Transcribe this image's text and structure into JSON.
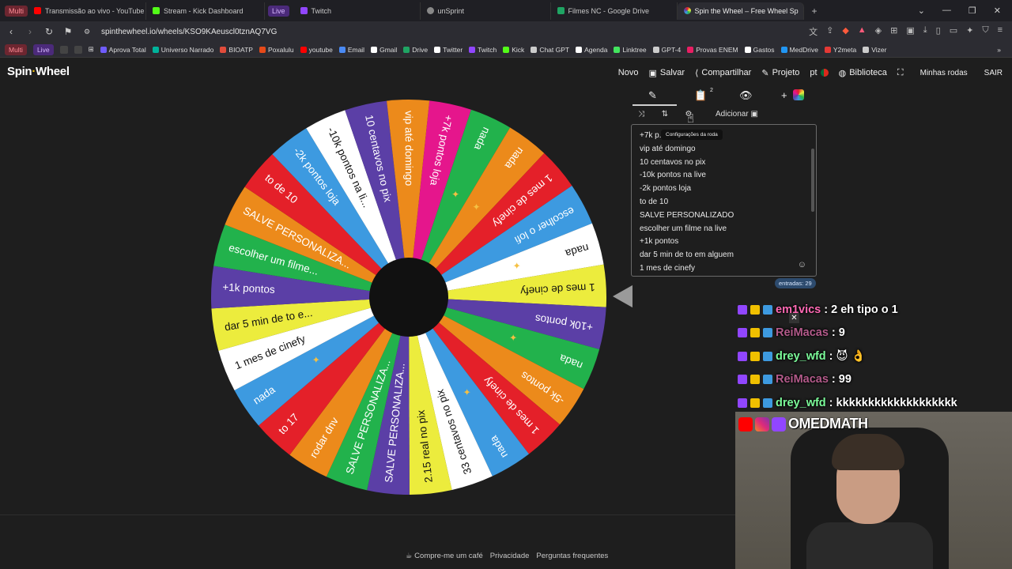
{
  "browser": {
    "profile_chip": "Multi",
    "tabs": [
      {
        "label": "Transmissão ao vivo - YouTube Studio",
        "color": "#ff0000"
      },
      {
        "label": "Stream - Kick Dashboard",
        "color": "#53fc18"
      },
      {
        "label": "Twitch",
        "color": "#9146ff"
      },
      {
        "label": "unSprint",
        "color": "#aaaaaa"
      },
      {
        "label": "Filmes NC - Google Drive",
        "color": "#1fa463"
      },
      {
        "label": "Spin the Wheel – Free Wheel Sp",
        "color": "#3b82f6"
      }
    ],
    "tab_live_chip": "Live",
    "url": "spinthewheel.io/wheels/KSO9KAeuscl0tznAQ7VG",
    "bookmarks": [
      {
        "label": "Aprova Total",
        "color": "#6f5cff"
      },
      {
        "label": "Universo Narrado",
        "color": "#00b39b"
      },
      {
        "label": "BIOATP",
        "color": "#e24c3b"
      },
      {
        "label": "Poxalulu",
        "color": "#e64a19"
      },
      {
        "label": "youtube",
        "color": "#ff0000"
      },
      {
        "label": "Email",
        "color": "#4a8af4"
      },
      {
        "label": "Gmail",
        "color": "#ffffff"
      },
      {
        "label": "Drive",
        "color": "#1fa463"
      },
      {
        "label": "Twitter",
        "color": "#ffffff"
      },
      {
        "label": "Twitch",
        "color": "#9146ff"
      },
      {
        "label": "Kick",
        "color": "#53fc18"
      },
      {
        "label": "Chat GPT",
        "color": "#cccccc"
      },
      {
        "label": "Agenda",
        "color": "#ffffff"
      },
      {
        "label": "Linktree",
        "color": "#43e55e"
      },
      {
        "label": "GPT-4",
        "color": "#cccccc"
      },
      {
        "label": "Provas ENEM",
        "color": "#e91e63"
      },
      {
        "label": "Gastos",
        "color": "#ffffff"
      },
      {
        "label": "MedDrive",
        "color": "#2196f3"
      },
      {
        "label": "Y2meta",
        "color": "#e53935"
      },
      {
        "label": "Vizer",
        "color": "#cccccc"
      }
    ],
    "bookmark_chips": [
      "Multi",
      "Live"
    ]
  },
  "app": {
    "logo_main": "Spin",
    "logo_dot": "·",
    "logo_end": "Wheel",
    "menu": {
      "novo": "Novo",
      "salvar": "Salvar",
      "compartilhar": "Compartilhar",
      "projeto": "Projeto",
      "language": "pt",
      "biblioteca": "Biblioteca",
      "minhas_rodas": "Minhas rodas",
      "sair": "SAIR"
    }
  },
  "wheel": {
    "segments": [
      {
        "label": "+7k pontos loja",
        "color": "#e5168c"
      },
      {
        "label": "nada",
        "color": "#22b24c",
        "star": true
      },
      {
        "label": "nada",
        "color": "#ec8a1b",
        "star": true
      },
      {
        "label": "1 mes de cinefy",
        "color": "#e42029"
      },
      {
        "label": "escolher o lofi",
        "color": "#3d9ae0"
      },
      {
        "label": "nada",
        "color": "#ffffff",
        "star": true
      },
      {
        "label": "1 mes de cinefy",
        "color": "#ecec3d"
      },
      {
        "label": "+10k pontos",
        "color": "#5b3fa6"
      },
      {
        "label": "nada",
        "color": "#22b24c",
        "star": true
      },
      {
        "label": "-5k pontos",
        "color": "#ec8a1b"
      },
      {
        "label": "1 mes de cinefy",
        "color": "#e42029"
      },
      {
        "label": "nada",
        "color": "#3d9ae0",
        "star": true
      },
      {
        "label": "33 centavos no pix",
        "color": "#ffffff"
      },
      {
        "label": "2.15 real no pix",
        "color": "#ecec3d"
      },
      {
        "label": "SALVE PERSONALIZA...",
        "color": "#5b3fa6"
      },
      {
        "label": "SALVE PERSONALIZA...",
        "color": "#22b24c"
      },
      {
        "label": "rodar dnv",
        "color": "#ec8a1b"
      },
      {
        "label": "to 17",
        "color": "#e42029"
      },
      {
        "label": "nada",
        "color": "#3d9ae0",
        "star": true
      },
      {
        "label": "1 mes de cinefy",
        "color": "#ffffff"
      },
      {
        "label": "dar 5 min de to e...",
        "color": "#ecec3d"
      },
      {
        "label": "+1k pontos",
        "color": "#5b3fa6"
      },
      {
        "label": "escolher um filme...",
        "color": "#22b24c"
      },
      {
        "label": "SALVE PERSONALIZA...",
        "color": "#ec8a1b"
      },
      {
        "label": "to de 10",
        "color": "#e42029"
      },
      {
        "label": "-2k pontos loja",
        "color": "#3d9ae0"
      },
      {
        "label": "-10k pontos na li...",
        "color": "#ffffff"
      },
      {
        "label": "10 centavos no pix",
        "color": "#5b3fa6"
      },
      {
        "label": "vip até domingo",
        "color": "#ec8a1b"
      }
    ]
  },
  "editor": {
    "add_label": "Adicionar",
    "tooltip": "Configurações da roda",
    "notes_count": "2",
    "entries": [
      "+7k p...",
      "vip até domingo",
      "10 centavos no pix",
      "-10k pontos na live",
      "-2k pontos loja",
      "to de 10",
      "SALVE PERSONALIZADO",
      "escolher um filme na live",
      "+1k pontos",
      "dar 5 min de to em alguem",
      "1 mes de cinefy",
      "nada"
    ],
    "count_label": "entradas: 29"
  },
  "chat": [
    {
      "user": "em1vics",
      "user_color": "#ff69b4",
      "message": ": 2 eh tipo o 1"
    },
    {
      "user": "ReiMacas",
      "user_color": "#b35a8a",
      "message": ": 9"
    },
    {
      "user": "drey_wfd",
      "user_color": "#7cfc9a",
      "message": ": 😈 👌"
    },
    {
      "user": "ReiMacas",
      "user_color": "#b35a8a",
      "message": ": 99"
    },
    {
      "user": "drey_wfd",
      "user_color": "#7cfc9a",
      "message": ": kkkkkkkkkkkkkkkkkkk"
    }
  ],
  "webcam": {
    "handle": "OMEDMATH"
  },
  "footer": {
    "coffee": "Compre-me um café",
    "privacy": "Privacidade",
    "faq": "Perguntas frequentes"
  }
}
